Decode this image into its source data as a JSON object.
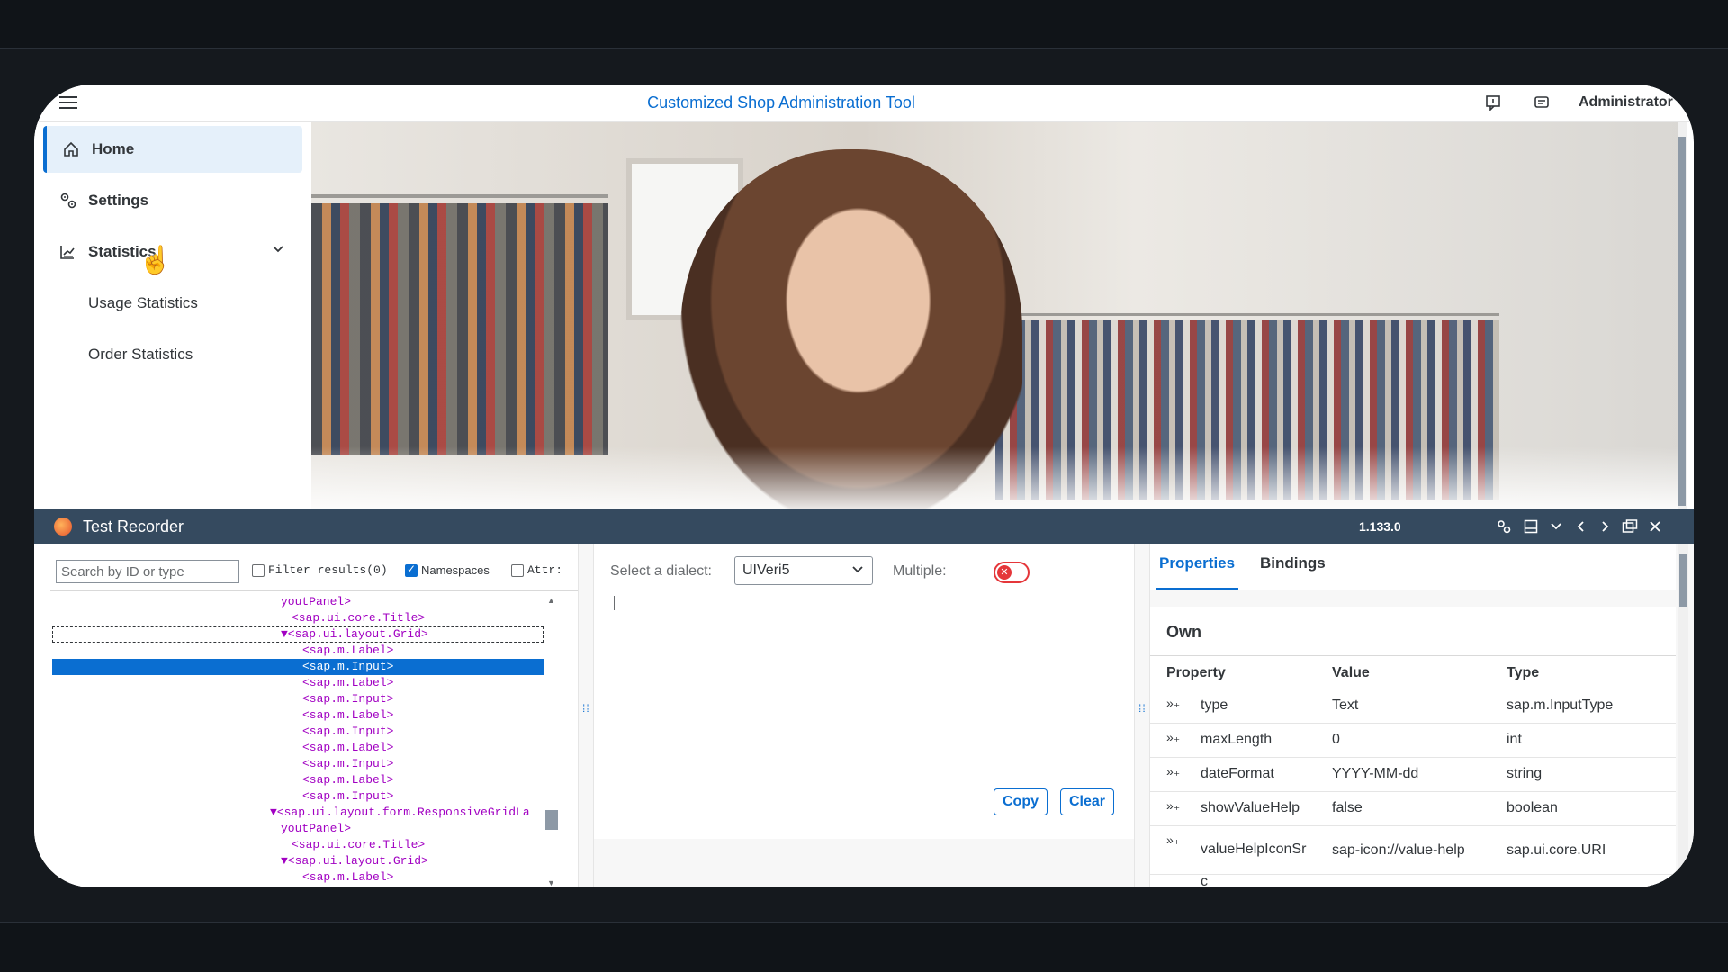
{
  "shell": {
    "title": "Customized Shop Administration Tool",
    "user": "Administrator",
    "icons": [
      "feedback-icon",
      "message-icon"
    ]
  },
  "sidenav": {
    "items": [
      {
        "label": "Home",
        "icon": "home-icon",
        "selected": true
      },
      {
        "label": "Settings",
        "icon": "settings-icon"
      },
      {
        "label": "Statistics",
        "icon": "chart-icon",
        "expanded": true
      },
      {
        "label": "Usage Statistics"
      },
      {
        "label": "Order Statistics"
      }
    ]
  },
  "recorder": {
    "title": "Test Recorder",
    "version": "1.133.0",
    "left": {
      "search_placeholder": "Search by ID or type",
      "filter_label": "Filter results(0)",
      "namespaces_label": "Namespaces",
      "attr_label": "Attr:",
      "tree": [
        "youtPanel>",
        "<sap.ui.core.Title>",
        "▼<sap.ui.layout.Grid>",
        "<sap.m.Label>",
        "<sap.m.Input>",
        "<sap.m.Label>",
        "<sap.m.Input>",
        "<sap.m.Label>",
        "<sap.m.Input>",
        "<sap.m.Label>",
        "<sap.m.Input>",
        "<sap.m.Label>",
        "<sap.m.Input>",
        "▼<sap.ui.layout.form.ResponsiveGridLa",
        "youtPanel>",
        "<sap.ui.core.Title>",
        "▼<sap.ui.layout.Grid>",
        "<sap.m.Label>"
      ]
    },
    "middle": {
      "dialect_label": "Select a dialect:",
      "dialect_value": "UIVeri5",
      "multiple_label": "Multiple:",
      "copy_label": "Copy",
      "clear_label": "Clear"
    },
    "right": {
      "tabs": [
        "Properties",
        "Bindings"
      ],
      "section_title": "Own",
      "columns": [
        "Property",
        "Value",
        "Type"
      ],
      "rows": [
        {
          "property": "type",
          "value": "Text",
          "type": "sap.m.InputType"
        },
        {
          "property": "maxLength",
          "value": "0",
          "type": "int"
        },
        {
          "property": "dateFormat",
          "value": "YYYY-MM-dd",
          "type": "string"
        },
        {
          "property": "showValueHelp",
          "value": "false",
          "type": "boolean"
        },
        {
          "property": "valueHelpIconSr",
          "property_cont": "c",
          "value": "sap-icon://value-help",
          "type": "sap.ui.core.URI"
        }
      ]
    }
  },
  "colors": {
    "accent": "#0a6ed1",
    "recorder_header": "#354a5f",
    "tree_text": "#a100c2",
    "toggle_off": "#e5363a"
  }
}
